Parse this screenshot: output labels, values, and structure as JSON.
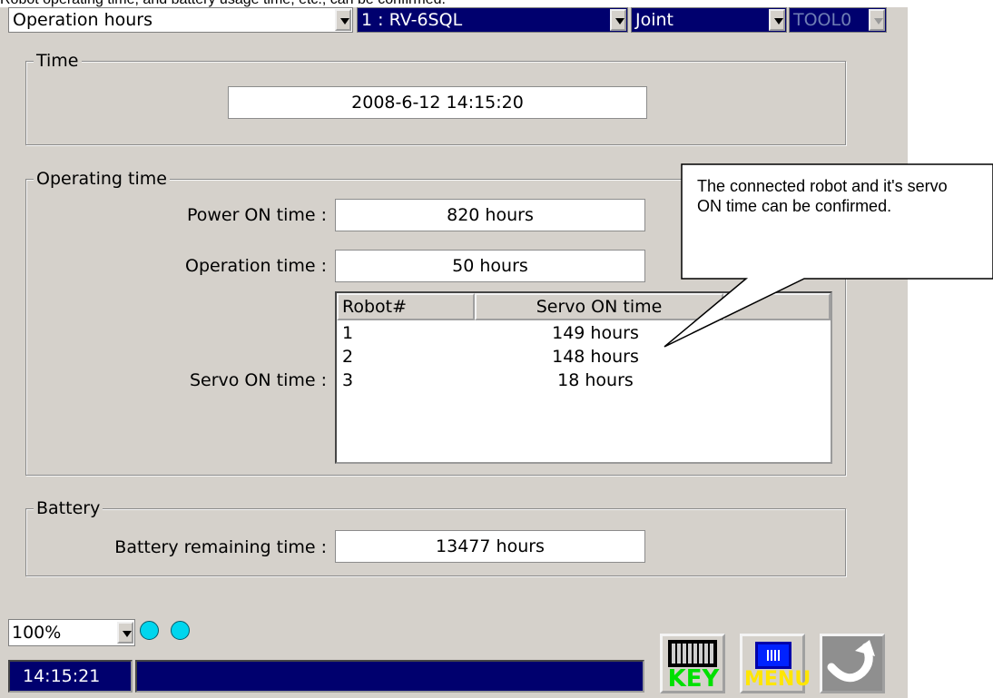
{
  "caption": "Robot operating time, and battery usage time, etc., can be confirmed.",
  "topbar": {
    "screen_select": "Operation hours",
    "robot_select": "1 : RV-6SQL",
    "coord_select": "Joint",
    "tool_select": "TOOL0"
  },
  "time": {
    "title": "Time",
    "value": "2008-6-12 14:15:20"
  },
  "operating": {
    "title": "Operating time",
    "power_on_label": "Power ON time :",
    "power_on_value": "820 hours",
    "operation_label": "Operation time :",
    "operation_value": "50 hours",
    "servo_label": "Servo ON time :",
    "columns": [
      "Robot#",
      "Servo ON time"
    ],
    "rows": [
      {
        "robot": "1",
        "servo": "149 hours"
      },
      {
        "robot": "2",
        "servo": "148 hours"
      },
      {
        "robot": "3",
        "servo": "18 hours"
      }
    ]
  },
  "battery": {
    "title": "Battery",
    "remaining_label": "Battery remaining time :",
    "remaining_value": "13477 hours"
  },
  "callout": {
    "text": "The connected robot and it's servo ON time can be confirmed."
  },
  "bottom": {
    "zoom": "100%",
    "clock": "14:15:21",
    "key_label": "KEY",
    "menu_label": "MENU"
  },
  "icons": [
    "dropdown-arrow-icon",
    "keyboard-icon",
    "menu-icon",
    "back-arrow-icon",
    "status-lamp-icon"
  ],
  "colors": {
    "panel": "#d5d1cb",
    "selection_blue": "#00006e",
    "lamp": "#00d6ee",
    "key_text": "#00e000",
    "menu_text": "#ffe600"
  }
}
